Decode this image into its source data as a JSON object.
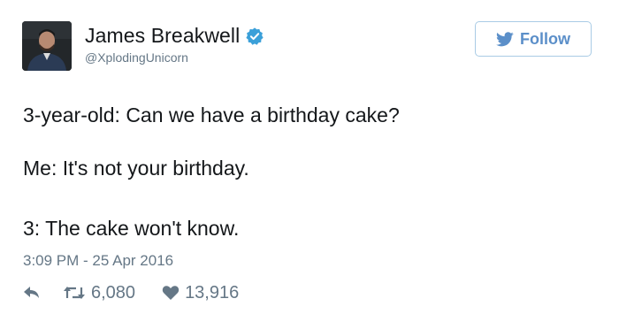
{
  "author": {
    "display_name": "James Breakwell",
    "handle": "@XplodingUnicorn",
    "verified": true,
    "avatar_icon": "profile-photo"
  },
  "follow_button": {
    "label": "Follow",
    "icon": "twitter-bird-icon"
  },
  "tweet": {
    "lines": [
      "3-year-old: Can we have a birthday cake?",
      "Me: It's not your birthday.",
      "3: The cake won't know."
    ],
    "timestamp": "3:09 PM - 25 Apr 2016"
  },
  "actions": {
    "reply_icon": "reply-icon",
    "retweet_icon": "retweet-icon",
    "retweet_count": "6,080",
    "like_icon": "heart-icon",
    "like_count": "13,916"
  },
  "colors": {
    "text": "#14171a",
    "secondary": "#657786",
    "accent": "#5b8fc9",
    "verified": "#3ba0d9",
    "follow_border": "#a9cbe5"
  }
}
